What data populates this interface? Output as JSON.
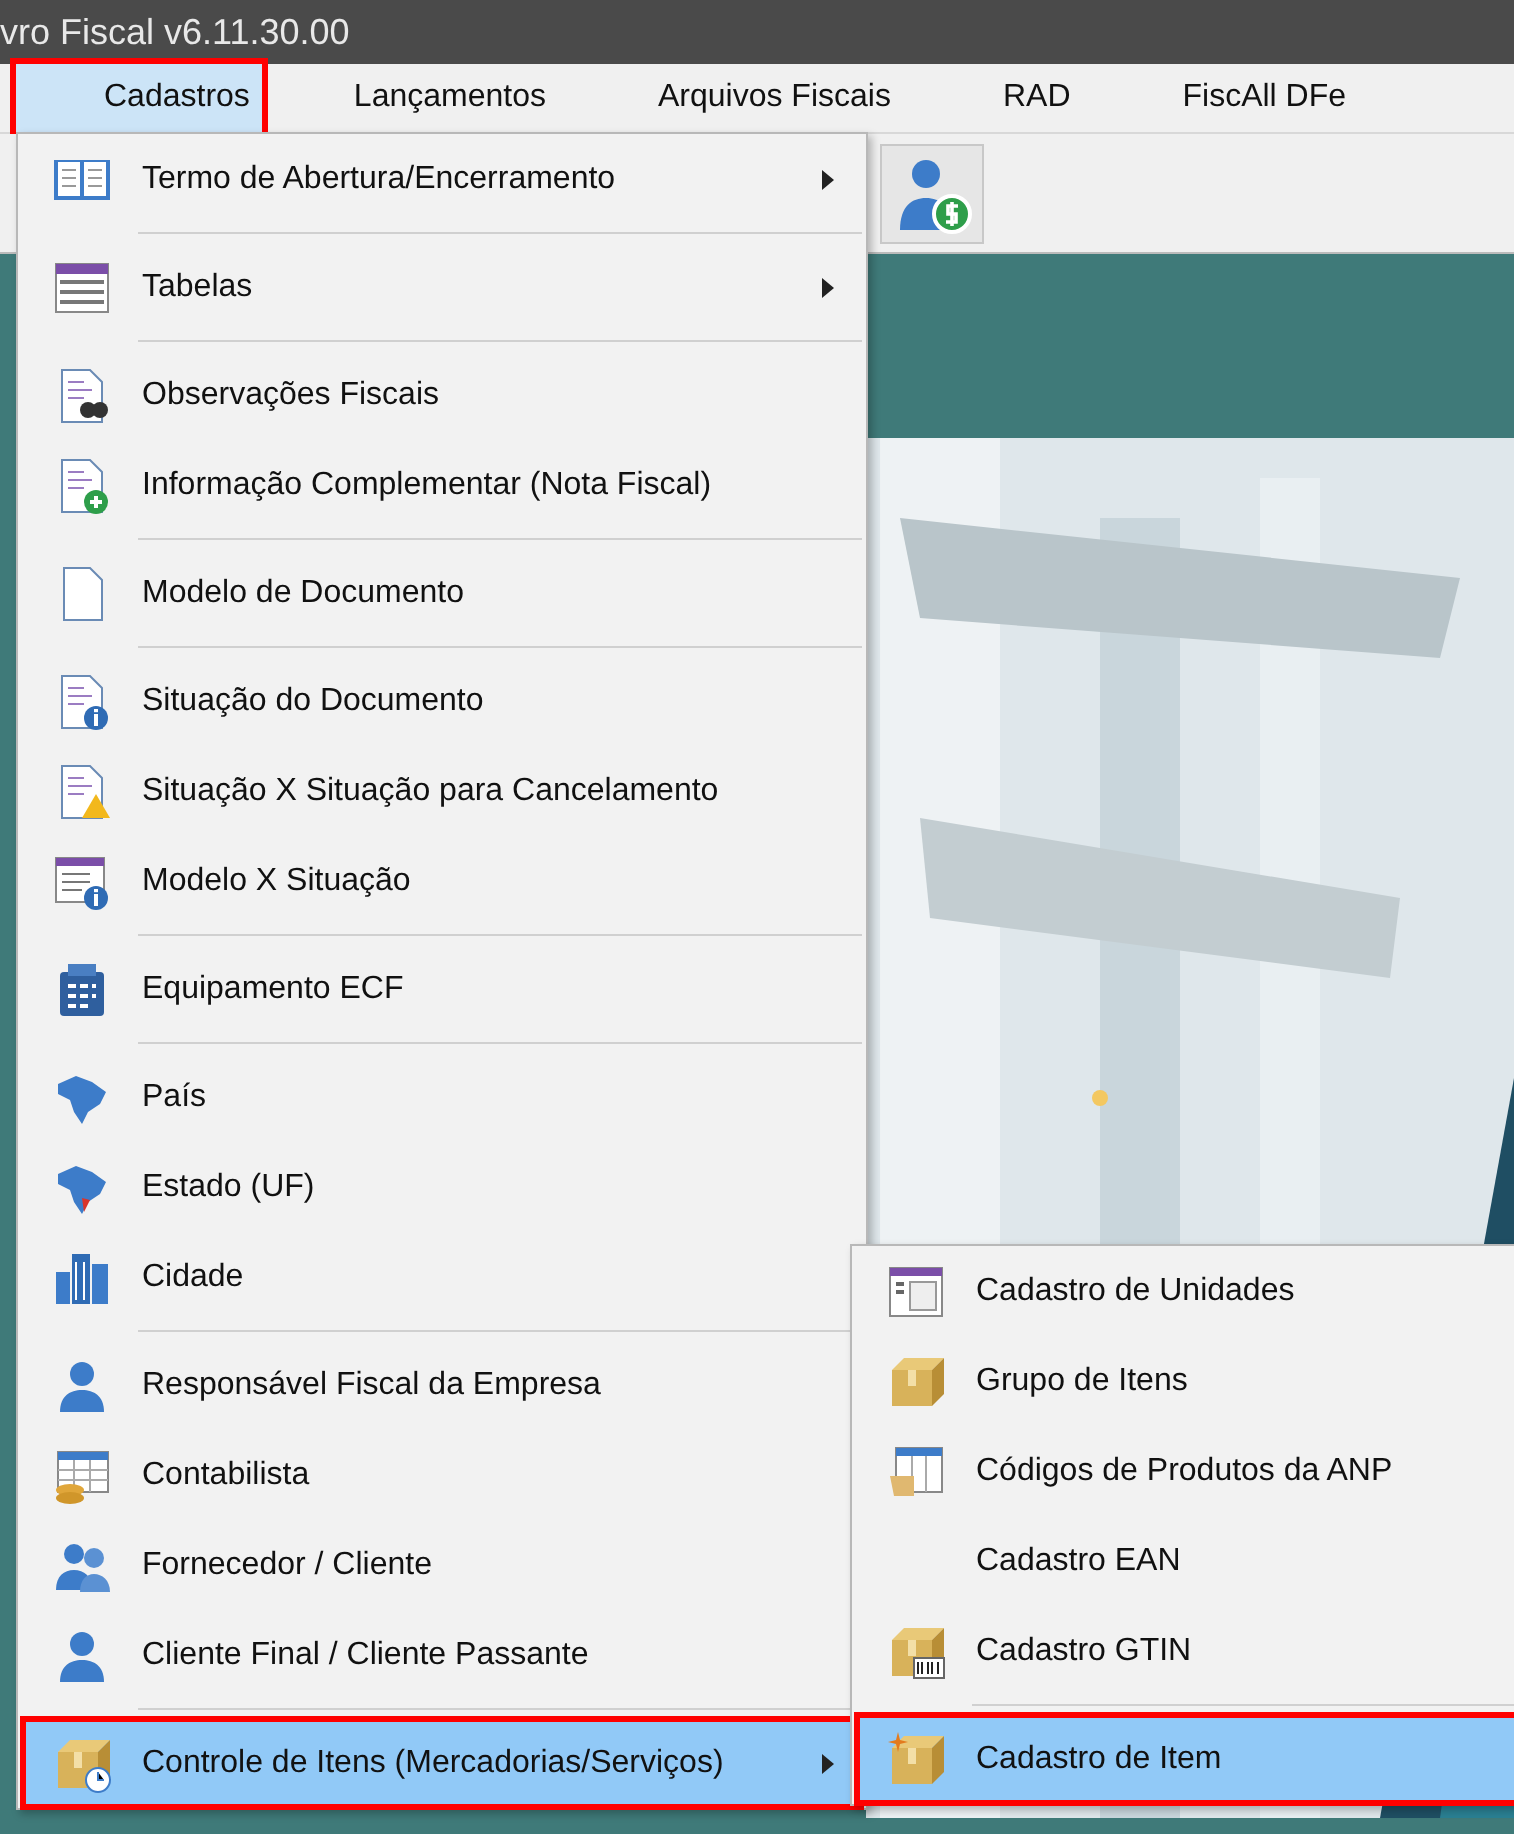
{
  "window": {
    "title": "vro Fiscal v6.11.30.00"
  },
  "menu_bar": [
    {
      "label": "Cadastros",
      "selected": true,
      "annotated": true
    },
    {
      "label": "Lançamentos",
      "selected": false,
      "annotated": false
    },
    {
      "label": "Arquivos Fiscais",
      "selected": false,
      "annotated": false
    },
    {
      "label": "RAD",
      "selected": false,
      "annotated": false
    },
    {
      "label": "FiscAll DFe",
      "selected": false,
      "annotated": false
    }
  ],
  "menu": {
    "items": [
      {
        "kind": "item",
        "label": "Termo de Abertura/Encerramento",
        "has_submenu": true,
        "selected": false,
        "annotated": false
      },
      {
        "kind": "separator"
      },
      {
        "kind": "item",
        "label": "Tabelas",
        "has_submenu": true,
        "selected": false,
        "annotated": false
      },
      {
        "kind": "separator"
      },
      {
        "kind": "item",
        "label": "Observações Fiscais",
        "has_submenu": false,
        "selected": false,
        "annotated": false
      },
      {
        "kind": "item",
        "label": "Informação Complementar (Nota Fiscal)",
        "has_submenu": false,
        "selected": false,
        "annotated": false
      },
      {
        "kind": "separator"
      },
      {
        "kind": "item",
        "label": "Modelo de Documento",
        "has_submenu": false,
        "selected": false,
        "annotated": false
      },
      {
        "kind": "separator"
      },
      {
        "kind": "item",
        "label": "Situação do Documento",
        "has_submenu": false,
        "selected": false,
        "annotated": false
      },
      {
        "kind": "item",
        "label": "Situação X Situação para Cancelamento",
        "has_submenu": false,
        "selected": false,
        "annotated": false
      },
      {
        "kind": "item",
        "label": "Modelo X Situação",
        "has_submenu": false,
        "selected": false,
        "annotated": false
      },
      {
        "kind": "separator"
      },
      {
        "kind": "item",
        "label": "Equipamento ECF",
        "has_submenu": false,
        "selected": false,
        "annotated": false
      },
      {
        "kind": "separator"
      },
      {
        "kind": "item",
        "label": "País",
        "has_submenu": false,
        "selected": false,
        "annotated": false
      },
      {
        "kind": "item",
        "label": "Estado (UF)",
        "has_submenu": false,
        "selected": false,
        "annotated": false
      },
      {
        "kind": "item",
        "label": "Cidade",
        "has_submenu": false,
        "selected": false,
        "annotated": false
      },
      {
        "kind": "separator"
      },
      {
        "kind": "item",
        "label": "Responsável Fiscal da Empresa",
        "has_submenu": false,
        "selected": false,
        "annotated": false
      },
      {
        "kind": "item",
        "label": "Contabilista",
        "has_submenu": false,
        "selected": false,
        "annotated": false
      },
      {
        "kind": "item",
        "label": "Fornecedor / Cliente",
        "has_submenu": false,
        "selected": false,
        "annotated": false
      },
      {
        "kind": "item",
        "label": "Cliente Final / Cliente Passante",
        "has_submenu": false,
        "selected": false,
        "annotated": false
      },
      {
        "kind": "separator"
      },
      {
        "kind": "item",
        "label": "Controle de Itens (Mercadorias/Serviços)",
        "has_submenu": true,
        "selected": true,
        "annotated": true
      }
    ]
  },
  "submenu": {
    "items": [
      {
        "kind": "item",
        "label": "Cadastro de Unidades",
        "has_submenu": false,
        "selected": false,
        "annotated": false
      },
      {
        "kind": "item",
        "label": "Grupo de Itens",
        "has_submenu": false,
        "selected": false,
        "annotated": false
      },
      {
        "kind": "item",
        "label": "Códigos de Produtos da ANP",
        "has_submenu": false,
        "selected": false,
        "annotated": false
      },
      {
        "kind": "item",
        "label": "Cadastro EAN",
        "has_submenu": false,
        "selected": false,
        "annotated": false
      },
      {
        "kind": "item",
        "label": "Cadastro GTIN",
        "has_submenu": false,
        "selected": false,
        "annotated": false
      },
      {
        "kind": "separator"
      },
      {
        "kind": "item",
        "label": "Cadastro de Item",
        "has_submenu": false,
        "selected": true,
        "annotated": true
      }
    ]
  }
}
